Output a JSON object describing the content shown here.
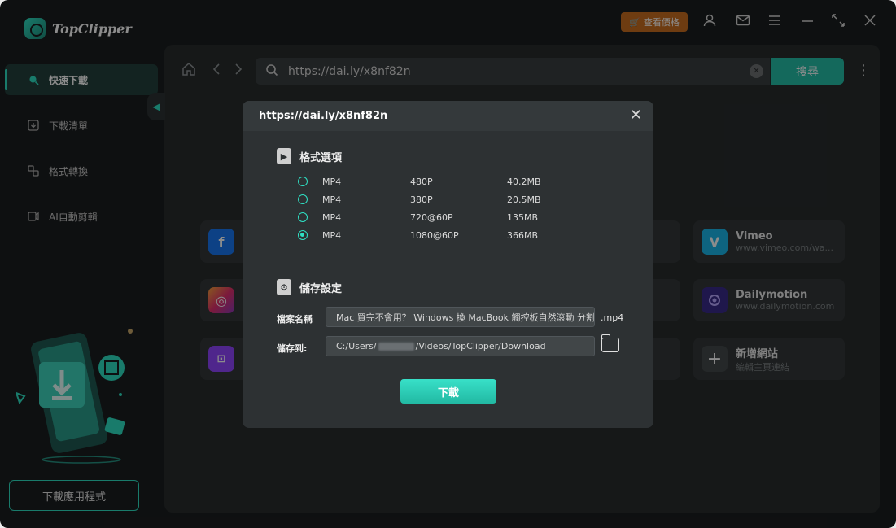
{
  "app": {
    "name": "TopClipper"
  },
  "titlebar": {
    "price_label": "查看價格"
  },
  "sidebar": {
    "items": [
      {
        "label": "快速下載",
        "icon": "search-icon",
        "active": true
      },
      {
        "label": "下載清單",
        "icon": "download-list-icon",
        "active": false
      },
      {
        "label": "格式轉換",
        "icon": "convert-icon",
        "active": false
      },
      {
        "label": "AI自動剪輯",
        "icon": "ai-edit-icon",
        "active": false
      }
    ],
    "download_app_label": "下載應用程式"
  },
  "browser": {
    "url": "https://dai.ly/x8nf82n",
    "search_label": "搜尋"
  },
  "sites": [
    {
      "name": "Vimeo",
      "url": "www.vimeo.com/wa...",
      "color": "#1ab7ea"
    },
    {
      "name": "Dailymotion",
      "url": "www.dailymotion.com",
      "color": "#3a2a8a"
    },
    {
      "name": "新增網站",
      "url": "編輯主頁連結",
      "color": "#44494b"
    }
  ],
  "partial_sites": [
    {
      "icon": "facebook-icon",
      "color": "#1877f2"
    },
    {
      "icon": "instagram-icon",
      "color": "#e1306c"
    },
    {
      "icon": "twitch-icon",
      "color": "#9146ff"
    }
  ],
  "dialog": {
    "title": "https://dai.ly/x8nf82n",
    "format_section": "格式選項",
    "formats": [
      {
        "format": "MP4",
        "resolution": "480P",
        "size": "40.2MB",
        "selected": false
      },
      {
        "format": "MP4",
        "resolution": "380P",
        "size": "20.5MB",
        "selected": false
      },
      {
        "format": "MP4",
        "resolution": "720@60P",
        "size": "135MB",
        "selected": false
      },
      {
        "format": "MP4",
        "resolution": "1080@60P",
        "size": "366MB",
        "selected": true
      }
    ],
    "save_section": "儲存設定",
    "filename_label": "檔案名稱",
    "filename_value": "Mac 買完不會用？ Windows 換 MacBook 觸控板自然滾動 分割",
    "extension": ".mp4",
    "saveto_label": "儲存到:",
    "path_prefix": "C:/Users/",
    "path_suffix": "/Videos/TopClipper/Download",
    "download_label": "下載"
  },
  "colors": {
    "accent": "#2fe0c4",
    "price": "#c96e1f",
    "search": "#26bfa8"
  }
}
